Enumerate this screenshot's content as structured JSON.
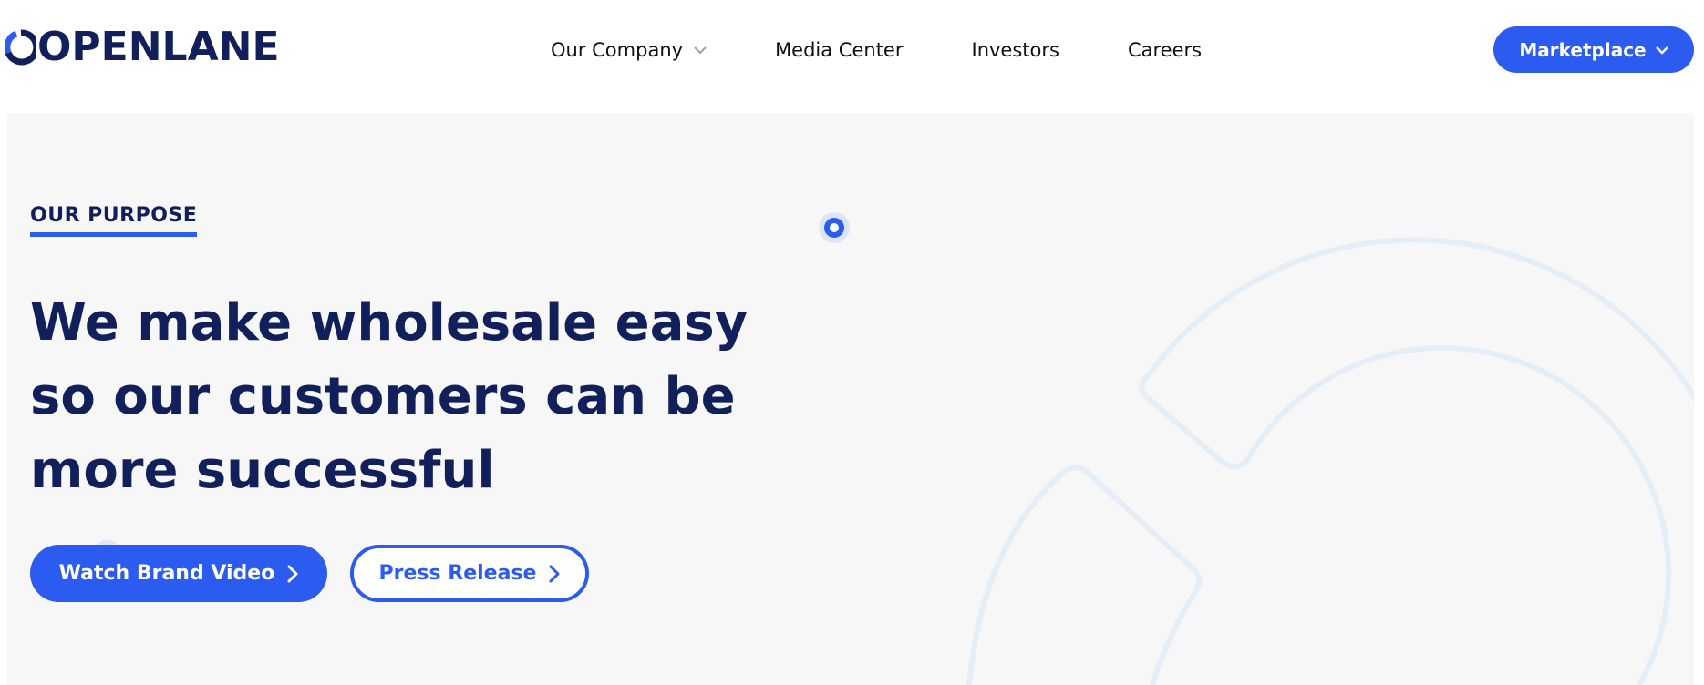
{
  "header": {
    "logo_text": "OPENLANE",
    "nav": [
      {
        "label": "Our Company",
        "has_dropdown": true
      },
      {
        "label": "Media Center",
        "has_dropdown": false
      },
      {
        "label": "Investors",
        "has_dropdown": false
      },
      {
        "label": "Careers",
        "has_dropdown": false
      }
    ],
    "marketplace_label": "Marketplace"
  },
  "hero": {
    "eyebrow": "OUR PURPOSE",
    "headline": "We make wholesale easy so our customers can be more successful",
    "primary_button": "Watch Brand Video",
    "secondary_button": "Press Release"
  },
  "colors": {
    "brand_navy": "#11205b",
    "accent_blue": "#2c5bf0",
    "hero_bg": "#f7f7f7",
    "decor_line": "#e3eef8"
  },
  "icons": [
    "openlane-logo-icon",
    "chevron-down-icon",
    "chevron-right-icon",
    "ring-dot-icon"
  ]
}
